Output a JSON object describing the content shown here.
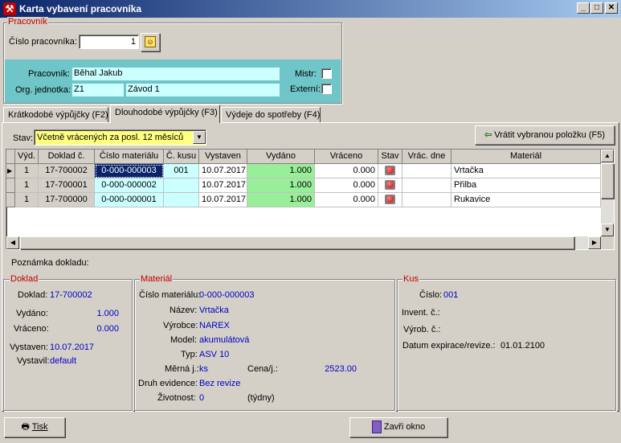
{
  "window": {
    "title": "Karta vybavení pracovníka",
    "minimize": "_",
    "maximize": "□",
    "close": "✕"
  },
  "pracovnik_group": {
    "title": "Pracovník",
    "cislo_label": "Číslo pracovníka:",
    "cislo_value": "1",
    "pracovnik_label": "Pracovník:",
    "pracovnik_value": "Běhal Jakub",
    "org_label": "Org. jednotka:",
    "org_code": "Z1",
    "org_name": "Závod 1",
    "mistr_label": "Mistr:",
    "externi_label": "Externí:"
  },
  "tabs": [
    {
      "label": "Krátkodobé výpůjčky (F2)"
    },
    {
      "label": "Dlouhodobé výpůjčky (F3)"
    },
    {
      "label": "Výdeje do spotřeby (F4)"
    }
  ],
  "filter": {
    "stav_label": "Stav:",
    "stav_value": "Včetně vrácených za posl. 12 měsíců",
    "vratit_button": "Vrátit vybranou položku (F5)"
  },
  "table": {
    "columns": [
      "Výd.",
      "Doklad č.",
      "Číslo materiálu",
      "Č. kusu",
      "Vystaven",
      "Vydáno",
      "Vráceno",
      "Stav",
      "Vrác. dne",
      "Materiál"
    ],
    "rows": [
      {
        "vyd": "1",
        "doklad": "17-700002",
        "cislo_materialu": "0-000-000003",
        "kus": "001",
        "vystaven": "10.07.2017",
        "vydano": "1.000",
        "vraceno": "0.000",
        "vrac_dne": "",
        "material": "Vrtačka"
      },
      {
        "vyd": "1",
        "doklad": "17-700001",
        "cislo_materialu": "0-000-000002",
        "kus": "",
        "vystaven": "10.07.2017",
        "vydano": "1.000",
        "vraceno": "0.000",
        "vrac_dne": "",
        "material": "Přilba"
      },
      {
        "vyd": "1",
        "doklad": "17-700000",
        "cislo_materialu": "0-000-000001",
        "kus": "",
        "vystaven": "10.07.2017",
        "vydano": "1.000",
        "vraceno": "0.000",
        "vrac_dne": "",
        "material": "Rukavice"
      }
    ]
  },
  "poznamka_label": "Poznámka dokladu:",
  "doklad": {
    "title": "Doklad",
    "doklad_label": "Doklad:",
    "doklad_value": "17-700002",
    "vydano_label": "Vydáno:",
    "vydano_value": "1.000",
    "vraceno_label": "Vráceno:",
    "vraceno_value": "0.000",
    "vystaven_label": "Vystaven:",
    "vystaven_value": "10.07.2017",
    "vystavil_label": "Vystavil:",
    "vystavil_value": "default"
  },
  "material": {
    "title": "Materiál",
    "cislo_label": "Číslo materiálu:",
    "cislo_value": "0-000-000003",
    "nazev_label": "Název:",
    "nazev_value": "Vrtačka",
    "vyrobce_label": "Výrobce:",
    "vyrobce_value": "NAREX",
    "model_label": "Model:",
    "model_value": "akumulátová",
    "typ_label": "Typ:",
    "typ_value": "ASV 10",
    "merna_label": "Měrná j.:",
    "merna_value": "ks",
    "cena_label": "Cena/j.:",
    "cena_value": "2523.00",
    "druh_label": "Druh evidence:",
    "druh_value": "Bez revize",
    "zivotnost_label": "Životnost:",
    "zivotnost_value": "0",
    "zivotnost_unit": "(týdny)"
  },
  "kus": {
    "title": "Kus",
    "cislo_label": "Číslo:",
    "cislo_value": "001",
    "invent_label": "Invent. č.:",
    "vyrob_label": "Výrob. č.:",
    "datum_label": "Datum expirace/revize.:",
    "datum_value": "01.01.2100"
  },
  "footer": {
    "tisk_button": "Tisk",
    "zavri_button": "Zavři okno"
  },
  "colors": {
    "group_title": "#c00000",
    "value_blue": "#0000c0",
    "info_panel": "#6fc5c7",
    "readonly_field": "#ccffff",
    "stav_combo": "#ffff80",
    "vydano_cell": "#99ee99",
    "selected_cell": "#0a246a"
  }
}
